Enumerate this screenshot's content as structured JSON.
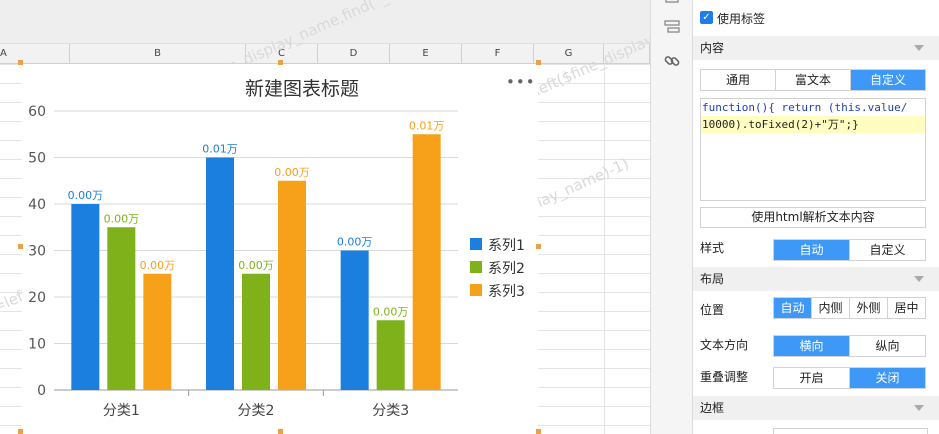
{
  "sheet": {
    "columns": [
      "A",
      "B",
      "C",
      "D",
      "E",
      "F",
      "G"
    ],
    "watermark": "=left($fine_display_name,find(\"_\",$fine_display_name)-1)"
  },
  "chart": {
    "title": "新建图表标题",
    "more_icon": "more-icon",
    "colors": {
      "series1": "#1a7fde",
      "series2": "#7fb21a",
      "series3": "#f7a01a"
    }
  },
  "chart_data": {
    "type": "bar",
    "title": "新建图表标题",
    "categories": [
      "分类1",
      "分类2",
      "分类3"
    ],
    "series": [
      {
        "name": "系列1",
        "values": [
          40,
          50,
          30
        ],
        "labels": [
          "0.00万",
          "0.01万",
          "0.00万"
        ]
      },
      {
        "name": "系列2",
        "values": [
          35,
          25,
          15
        ],
        "labels": [
          "0.00万",
          "0.00万",
          "0.00万"
        ]
      },
      {
        "name": "系列3",
        "values": [
          25,
          45,
          55
        ],
        "labels": [
          "0.00万",
          "0.00万",
          "0.01万"
        ]
      }
    ],
    "yticks": [
      "0",
      "10",
      "20",
      "30",
      "40",
      "50",
      "60"
    ],
    "ylim": [
      0,
      60
    ],
    "grid": true,
    "legend": "right"
  },
  "panel": {
    "use_label": "使用标签",
    "content": {
      "title": "内容",
      "tabs": [
        "通用",
        "富文本",
        "自定义"
      ],
      "active_tab": "自定义",
      "code_line1_a": "function(){ return ",
      "code_line1_b": "(this.value/",
      "code_line2": "10000).toFixed(2)+\"万\";}",
      "html_button": "使用html解析文本内容"
    },
    "style": {
      "label": "样式",
      "options": [
        "自动",
        "自定义"
      ],
      "active": "自动"
    },
    "layout": {
      "title": "布局",
      "position_label": "位置",
      "position_options": [
        "自动",
        "内侧",
        "外侧",
        "居中"
      ],
      "position_active": "自动",
      "direction_label": "文本方向",
      "direction_options": [
        "横向",
        "纵向"
      ],
      "direction_active": "横向",
      "overlap_label": "重叠调整",
      "overlap_options": [
        "开启",
        "关闭"
      ],
      "overlap_active": "关闭"
    },
    "border": {
      "title": "边框"
    }
  }
}
